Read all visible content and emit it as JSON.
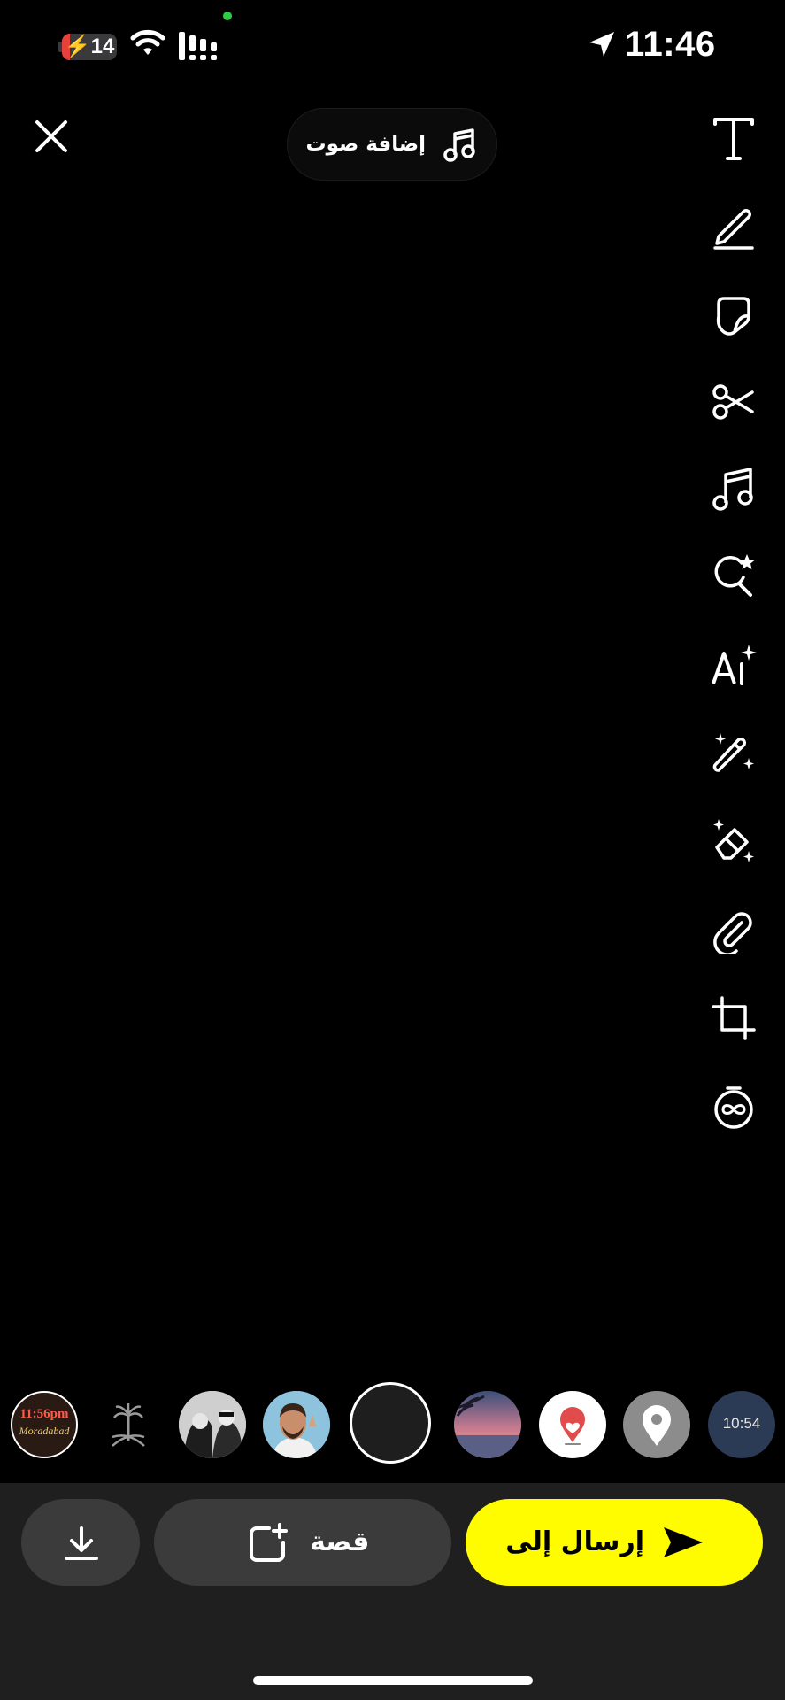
{
  "status_bar": {
    "battery_level": "14",
    "battery_fraction": 0.14,
    "time": "11:46",
    "battery_color": "#e8413b",
    "privacy_indicator_color": "#2ecc40"
  },
  "top": {
    "close_icon": "close-icon",
    "add_sound_label": "إضافة صوت",
    "add_sound_icon": "music-note-icon"
  },
  "toolbar": {
    "items": [
      "text",
      "draw",
      "sticker",
      "scissors",
      "music",
      "lens-search",
      "ai-text",
      "magic-wand",
      "magic-eraser",
      "attachment",
      "crop",
      "timer"
    ]
  },
  "lenses": {
    "items": [
      {
        "name": "moradabad-time-lens",
        "text_time": "11:56pm",
        "text_place": "Moradabad"
      },
      {
        "name": "saudi-emblem-lens"
      },
      {
        "name": "couple-photo-lens"
      },
      {
        "name": "man-portrait-lens"
      },
      {
        "name": "capture-button"
      },
      {
        "name": "sunset-beach-lens"
      },
      {
        "name": "heart-location-lens"
      },
      {
        "name": "location-pin-lens"
      },
      {
        "name": "time-lens",
        "text_time": "10:54"
      }
    ]
  },
  "bottom_bar": {
    "save_icon": "download-icon",
    "story_label": "قصة",
    "story_icon": "add-story-icon",
    "send_label": "إرسال إلى",
    "send_icon": "send-arrow-icon",
    "send_color": "#fffc00"
  }
}
